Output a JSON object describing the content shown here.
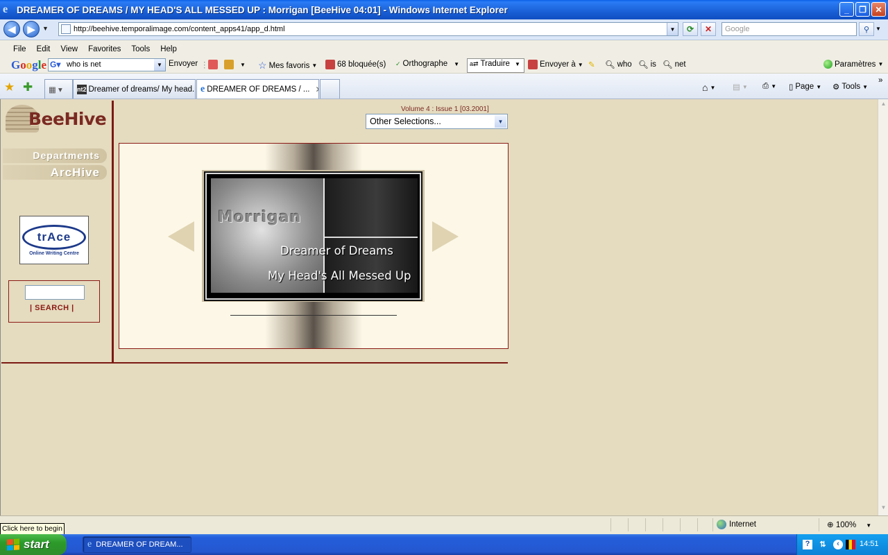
{
  "window": {
    "title": "DREAMER OF DREAMS / MY HEAD'S ALL MESSED UP : Morrigan [BeeHive 04:01] - Windows Internet Explorer",
    "controls": [
      "minimize-icon",
      "maximize-icon",
      "close-icon"
    ]
  },
  "address_bar": {
    "url": "http://beehive.temporalimage.com/content_apps41/app_d.html",
    "search_placeholder": "Google"
  },
  "menu": [
    "File",
    "Edit",
    "View",
    "Favorites",
    "Tools",
    "Help"
  ],
  "google_toolbar": {
    "logo": "Google",
    "query": "who is net",
    "send_label": "Envoyer",
    "favorites_label": "Mes favoris",
    "blocked_label": "68 bloquée(s)",
    "spell_label": "Orthographe",
    "translate_label": "Traduire",
    "send_to_label": "Envoyer à",
    "term1": "who",
    "term2": "is",
    "term3": "net",
    "settings_label": "Paramètres"
  },
  "tabs": [
    {
      "label": "Dreamer of dreams/ My head...",
      "icon": "nt2"
    },
    {
      "label": "DREAMER OF DREAMS / ...",
      "active": true
    }
  ],
  "command_bar": {
    "page_label": "Page",
    "tools_label": "Tools"
  },
  "page": {
    "logo_text": "BeeHive",
    "nav": {
      "departments": "Departments",
      "archive": "ArcHive"
    },
    "trace": {
      "logo_text": "trAce",
      "subtitle": "Online Writing Centre"
    },
    "search_button": "| SEARCH |",
    "issue_info": "Volume 4 : Issue 1  [03.2001]",
    "select_value": "Other Selections...",
    "artwork": {
      "author": "Morrigan",
      "line1": "Dreamer of Dreams",
      "line2": "My Head's All Messed Up"
    }
  },
  "status_bar": {
    "tooltip": "Click here to begin",
    "zone": "Internet",
    "zoom": "100%"
  },
  "taskbar": {
    "start_label": "start",
    "task": "DREAMER OF DREAM...",
    "clock": "14:51"
  }
}
